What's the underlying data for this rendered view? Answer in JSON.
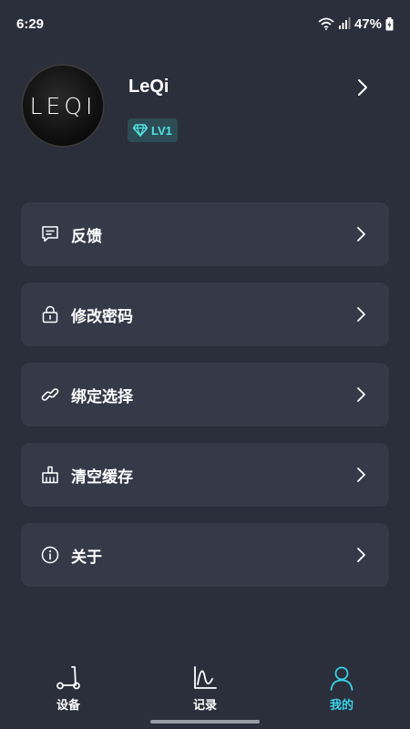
{
  "status_bar": {
    "time": "6:29",
    "battery": "47%"
  },
  "profile": {
    "avatar_text": "LEQI",
    "username": "LeQi",
    "level": "LV1"
  },
  "menu": {
    "items": [
      {
        "label": "反馈",
        "icon": "feedback-icon"
      },
      {
        "label": "修改密码",
        "icon": "lock-icon"
      },
      {
        "label": "绑定选择",
        "icon": "link-icon"
      },
      {
        "label": "清空缓存",
        "icon": "broom-icon"
      },
      {
        "label": "关于",
        "icon": "info-icon"
      }
    ]
  },
  "tabs": [
    {
      "label": "设备",
      "icon": "scooter-icon",
      "active": false
    },
    {
      "label": "记录",
      "icon": "chart-icon",
      "active": false
    },
    {
      "label": "我的",
      "icon": "user-icon",
      "active": true
    }
  ],
  "colors": {
    "background": "#2b2e3b",
    "card": "#353948",
    "accent": "#37d3e6",
    "badge_bg": "#2e4c55",
    "badge_text": "#4fe3e0"
  }
}
